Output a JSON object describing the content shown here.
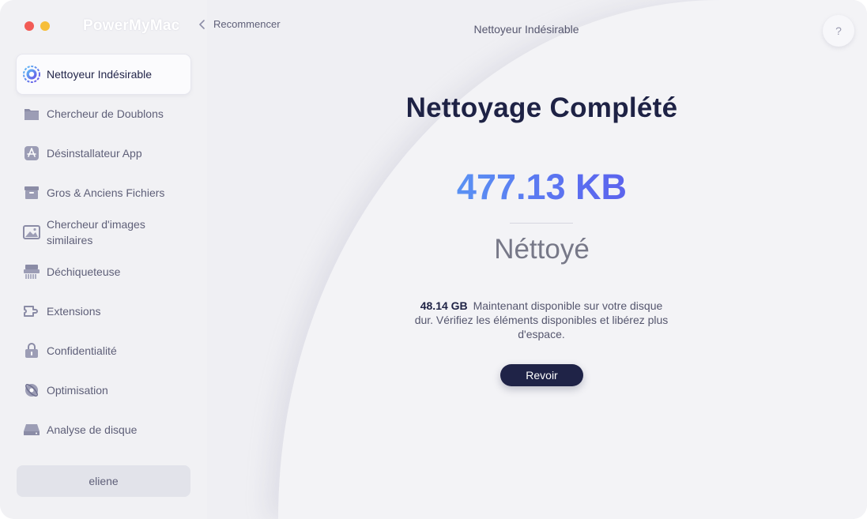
{
  "app": {
    "name": "PowerMyMac"
  },
  "colors": {
    "accent": "#1f2347",
    "gradient_start": "#5ab0f6",
    "gradient_end": "#5a4ee6"
  },
  "header": {
    "back_label": "Recommencer",
    "title": "Nettoyeur Indésirable",
    "help_label": "?"
  },
  "sidebar": {
    "items": [
      {
        "label": "Nettoyeur Indésirable",
        "icon": "junk-cleaner-icon",
        "active": true
      },
      {
        "label": "Chercheur de Doublons",
        "icon": "folder-icon"
      },
      {
        "label": "Désinstallateur App",
        "icon": "app-store-icon"
      },
      {
        "label": "Gros & Anciens Fichiers",
        "icon": "archive-box-icon"
      },
      {
        "label_line1": "Chercheur d'images",
        "label_line2": "similaires",
        "icon": "image-icon"
      },
      {
        "label": "Déchiqueteuse",
        "icon": "shredder-icon"
      },
      {
        "label": "Extensions",
        "icon": "plugin-icon"
      },
      {
        "label": "Confidentialité",
        "icon": "lock-icon"
      },
      {
        "label": "Optimisation",
        "icon": "optimization-icon"
      },
      {
        "label": "Analyse de disque",
        "icon": "disk-icon"
      }
    ],
    "user": "eliene"
  },
  "main": {
    "title": "Nettoyage Complété",
    "amount": "477.13 KB",
    "cleaned_label": "Néttoyé",
    "info_size": "48.14 GB",
    "info_text": "Maintenant disponible sur votre disque dur. Vérifiez les éléments disponibles et libérez plus d'espace.",
    "review_button": "Revoir"
  }
}
